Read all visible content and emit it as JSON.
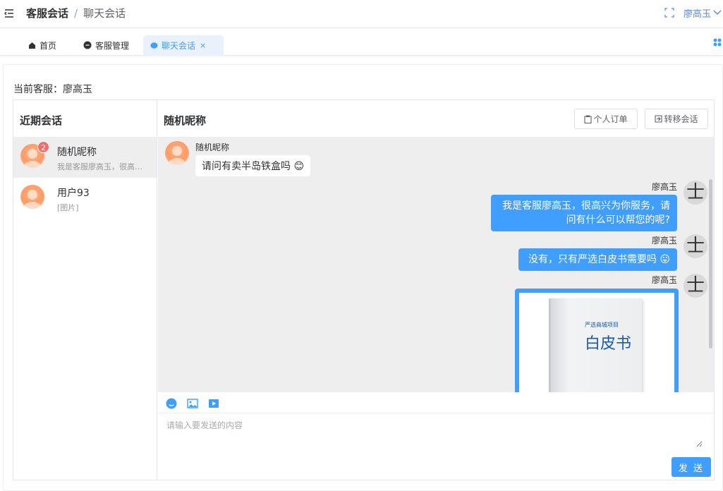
{
  "header": {
    "breadcrumb": [
      "客服会话",
      "聊天会话"
    ],
    "separator": "/",
    "user_name": "廖高玉"
  },
  "tabs": [
    {
      "label": "首页",
      "active": false
    },
    {
      "label": "客服管理",
      "active": false
    },
    {
      "label": "聊天会话",
      "active": true,
      "close": "×"
    }
  ],
  "current_agent": "当前客服：廖高玉",
  "sessions": {
    "title": "近期会话",
    "items": [
      {
        "name": "随机昵称",
        "preview": "我是客服廖高玉，很高兴为你服务，请问有什么可以帮您的呢?",
        "badge": "2",
        "active": true
      },
      {
        "name": "用户93",
        "preview": "[图片]",
        "badge": "",
        "active": false
      }
    ]
  },
  "chat": {
    "title": "随机昵称",
    "order_button": "个人订单",
    "transfer_button": "转移会话",
    "messages": [
      {
        "side": "left",
        "sender": "随机昵称",
        "text": "请问有卖半岛铁盒吗 😊"
      },
      {
        "side": "right",
        "sender": "廖高玉",
        "text": [
          "我是客服廖高玉，很高兴为你服务，请",
          "问有什么可以帮您的呢?"
        ]
      },
      {
        "side": "right",
        "sender": "廖高玉",
        "text": "没有，只有严选白皮书需要吗 😛"
      },
      {
        "side": "right",
        "sender": "廖高玉",
        "image_text_small": "严选商城项目",
        "image_text_large": "白皮书"
      }
    ],
    "agent_avatar_glyph": "士",
    "input_placeholder": "请输入要发送的内容",
    "send_button": "发 送"
  },
  "colors": {
    "accent": "#409eff",
    "badge": "#f56c6c",
    "link": "#5b8bd6"
  }
}
